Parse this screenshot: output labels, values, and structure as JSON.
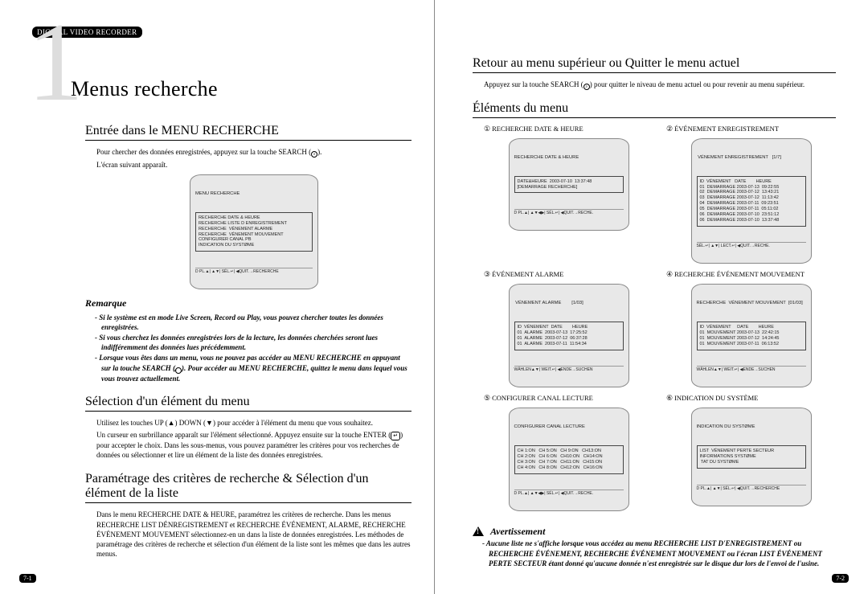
{
  "badge": "DIGITAL VIDEO RECORDER",
  "chapter_num": "1",
  "chapter_title": "Menus recherche",
  "left": {
    "sec1": {
      "title": "Entrée dans le MENU RECHERCHE",
      "p1a": "Pour chercher des données enregistrées, appuyez sur la touche SEARCH (",
      "p1b": ").",
      "p2": "L'écran suivant apparaît.",
      "screen": {
        "title": "MENU RECHERCHE",
        "lines": "RECHERCHE DATE & HEURE\nRECHERCHE LISTE D ENREGISTREMENT\nRECHERCHE  VÉNEMENT ALARME\nRECHERCHE  VÉNEMENT MOUVEMENT\nCONFIGURER CANAL PB\nINDICATION DU SYSTØME",
        "foot": "D PL.▲| ▲▼| SÉL.↵| ◀QUIT.→RECHERCHE"
      }
    },
    "remark": {
      "title": "Remarque",
      "i1": "Si le système est en mode Live Screen, Record ou Play, vous pouvez chercher toutes les données enregistrées.",
      "i2": "Si vous cherchez les données enregistrées lors de la lecture, les données cherchées seront lues indifféremment des données lues précédemment.",
      "i3a": "Lorsque vous êtes dans un menu, vous ne pouvez pas accéder au MENU RECHERCHE en appuyant sur la touche SEARCH (",
      "i3b": "). Pour accéder au MENU RECHERCHE, quittez le menu dans lequel vous vous trouvez actuellement."
    },
    "sec2": {
      "title": "Sélection d'un élément du menu",
      "p1a": "Utilisez les touches UP (▲) DOWN (▼) pour accéder à l'élément du menu que vous souhaitez.",
      "p2a": "Un curseur en surbrillance apparaît sur l'élément sélectionné. Appuyez ensuite sur la touche ENTER (",
      "p2b": ") pour accepter le choix. Dans les sous-menus, vous pouvez paramétrer les critères pour vos recherches de données ou sélectionner et lire un élément de la liste des données enregistrées."
    },
    "sec3": {
      "title": "Paramétrage des critères de recherche & Sélection d'un élément de la liste",
      "p1": "Dans le menu RECHERCHE DATE & HEURE, paramétrez les critères de recherche. Dans les menus RECHERCHE LIST DÉNREGISTREMENT et RECHERCHE ÉVÉNEMENT, ALARME, RECHERCHE ÉVÉNEMENT MOUVEMENT  sélectionnez-en un dans la liste de données enregistrées. Les méthodes de paramétrage des critères de recherche et sélection d'un élément de la liste sont les mêmes que dans les autres menus."
    },
    "pagenum": "7-1"
  },
  "right": {
    "sec1": {
      "title": "Retour au menu supérieur ou Quitter le menu actuel",
      "p1a": "Appuyez sur la touche SEARCH (",
      "p1b": ") pour quitter le niveau de menu actuel ou pour revenir au menu supérieur."
    },
    "sec2": {
      "title": "Éléments du menu",
      "items": [
        {
          "num": "①",
          "label": "RECHERCHE DATE & HEURE",
          "screen_title": "RECHERCHE DATE & HEURE",
          "screen_body": "DATE&HEURE  2003-07-10  13:37:48\n[DEMARRAGE RECHERCHE]",
          "screen_foot": "D PL.▲| ▲▼◀▶| SÉL.↵| ◀QUIT.→RECHE."
        },
        {
          "num": "②",
          "label": "ÉVÉNEMENT ENREGISTREMENT",
          "screen_title": " VÉNEMENT ENREGISTREMENT   [1/7]",
          "screen_body": "ID  VÉNEMENT   DATE        HEURE\n01  DEMARRAGE 2003-07-13  09:22:55\n02  DEMARRAGE 2003-07-12  13:43:21\n03  DEMARRAGE 2003-07-12  11:13:42\n04  DEMARRAGE 2003-07-11  09:23:51\n05  DEMARRAGE 2003-07-11  05:11:02\n06  DEMARRAGE 2003-07-10  23:51:12\n06  DEMARRAGE 2003-07-10  13:37:48",
          "screen_foot": "SÉL.↵| ▲▼| LECT.↵| ◀QUIT.→RECHE."
        },
        {
          "num": "③",
          "label": "ÉVÉNEMENT ALARME",
          "screen_title": " VÉNEMENT ALARME        [1/03]",
          "screen_body": "ID  VÉNEMENT  DATE        HEURE\n01  ALARME  2003-07-13  17:25:52\n01  ALARME  2003-07-12  06:37:28\n01  ALARME  2003-07-11  11:54:34",
          "screen_foot": "WÄHLEN▲▼| WEIT.↵| ◀ENDE→SUCHEN"
        },
        {
          "num": "④",
          "label": "RECHERCHE ÉVÉNEMENT MOUVEMENT",
          "screen_title": "RECHERCHE  VÉNEMENT MOUVEMENT  [01/03]",
          "screen_body": "ID  VÉNEMENT     DATE        HEURE\n01  MOUVEMENT 2003-07-13  22:42:15\n01  MOUVEMENT 2003-07-12  14:24:45\n01  MOUVEMENT 2003-07-11  06:13:52",
          "screen_foot": "WÄHLEN▲▼| WEIT.↵| ◀ENDE→SUCHEN"
        },
        {
          "num": "⑤",
          "label": "CONFIGURER CANAL LECTURE",
          "screen_title": "CONFIGURER CANAL LECTURE",
          "screen_body": "CH 1:ON   CH 5:ON   CH 9:ON   CH13:ON\nCH 2:ON   CH 6:ON   CH10:ON   CH14:ON\nCH 3:ON   CH 7:ON   CH11:ON   CH15:ON\nCH 4:ON   CH 8:ON   CH12:ON   CH16:ON",
          "screen_foot": "D PL.▲| ▲▼◀▶| SÉL.↵| ◀QUIT.→RECHE."
        },
        {
          "num": "⑥",
          "label": "INDICATION DU SYSTÈME",
          "screen_title": "INDICATION DU SYSTØME",
          "screen_body": "LIST  VÉNEMENT PERTE SECTEUR\nINFORMATIONS SYSTØME\n TAT DU SYSTØME",
          "screen_foot": "D PL.▲| ▲▼| SÉL.↵| ◀QUIT.→RECHERCHE"
        }
      ]
    },
    "avert": {
      "title": "Avertissement",
      "i1": "Aucune liste ne s'affiche lorsque vous accédez au menu RECHERCHE LIST D'EN­REGISTREMENT ou RECHERCHE ÉVÉNEMENT, RECHERCHE ÉVÉNEMENT MOU­VEMENT ou l'écran LIST ÉVÉNEMENT PERTE SECTEUR étant donné qu'aucune donnée n'est enregistrée sur le disque dur lors de l'envoi de l'usine."
    },
    "pagenum": "7-2"
  }
}
